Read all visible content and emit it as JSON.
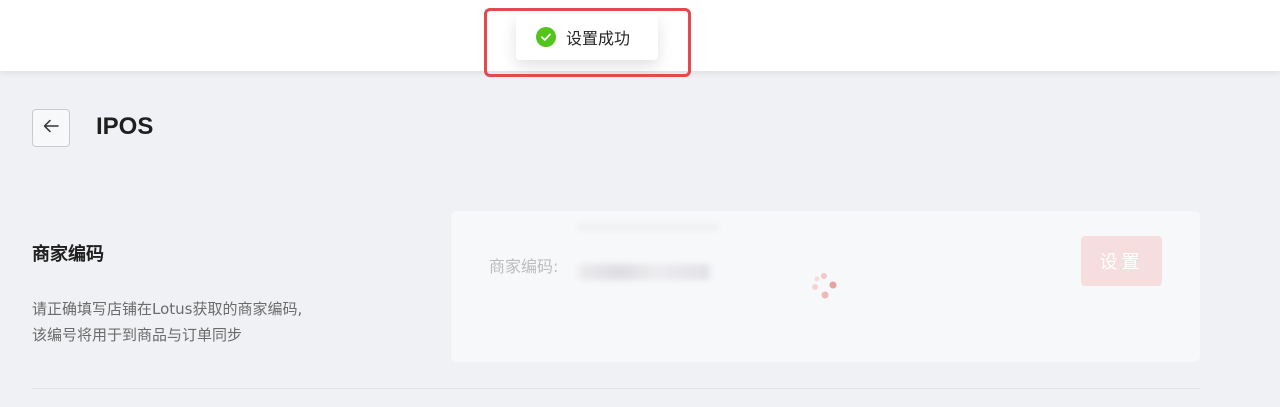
{
  "toast": {
    "icon": "check-circle-icon",
    "message": "设置成功",
    "highlight_color": "#e5484d",
    "icon_color": "#52c41a"
  },
  "header": {
    "back_icon": "arrow-left-icon",
    "title": "IPOS"
  },
  "section": {
    "title": "商家编码",
    "description_line1": "请正确填写店铺在Lotus获取的商家编码,",
    "description_line2": "该编号将用于到商品与订单同步"
  },
  "form": {
    "label": "商家编码:",
    "button_label": "设置",
    "button_color": "#f7dede",
    "spinner_color": "#e8a3a0"
  }
}
